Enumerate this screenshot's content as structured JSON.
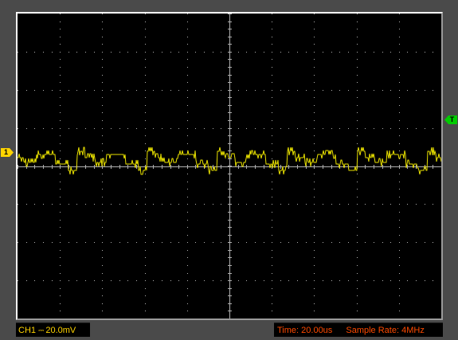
{
  "channel": {
    "marker": "1",
    "name": "CH1",
    "coupling_symbol": "⎓",
    "scale": "20.0mV",
    "color": "#ffd400"
  },
  "trigger": {
    "marker": "T",
    "color": "#00cc00"
  },
  "time_base": {
    "label": "Time:",
    "value": "20.00us"
  },
  "sample_rate": {
    "label": "Sample Rate:",
    "value": "4MHz"
  },
  "grid": {
    "columns": 10,
    "rows": 8
  },
  "colors": {
    "screen": "#000000",
    "grid": "#b0b0b0",
    "trace": "#e8e000",
    "status_text": "#ff4a00"
  }
}
